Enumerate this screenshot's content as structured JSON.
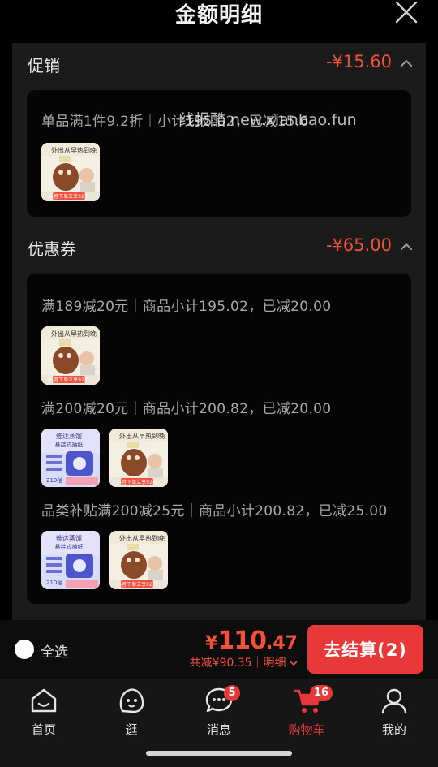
{
  "header": {
    "title": "金额明细"
  },
  "promo": {
    "title": "促销",
    "amount": "-¥15.60",
    "line": "单品满1件9.2折｜小计195.02，已减15.6"
  },
  "coupons": {
    "title": "优惠券",
    "amount": "-¥65.00",
    "lines": [
      "满189减20元｜商品小计195.02，已减20.00",
      "满200减20元｜商品小计200.82，已减20.00",
      "品类补贴满200减25元｜商品小计200.82，已减25.00"
    ]
  },
  "product_thumbs": {
    "bottle": {
      "banner": "外出从早热到晚",
      "tag": "抖音下单立享92折"
    },
    "wipes": {
      "banner": "维达蒸馏",
      "sub": "悬挂式抽纸",
      "count": "210抽"
    }
  },
  "watermark": "线报酷 new.xianbao.fun",
  "checkout": {
    "select_all": "全选",
    "total_symbol": "¥",
    "total_int": "110",
    "total_dec": ".47",
    "saved": "共减¥90.35｜明细",
    "pay_button": "去结算(2)"
  },
  "tabs": [
    {
      "label": "首页",
      "icon": "home-icon"
    },
    {
      "label": "逛",
      "icon": "face-icon"
    },
    {
      "label": "消息",
      "icon": "message-icon",
      "badge": "5"
    },
    {
      "label": "购物车",
      "icon": "cart-icon",
      "badge": "16",
      "active": true
    },
    {
      "label": "我的",
      "icon": "profile-icon"
    }
  ],
  "colors": {
    "accent": "#e8383a",
    "discount": "#f0503c",
    "card": "#050505",
    "sheet": "#1b1b1b"
  }
}
